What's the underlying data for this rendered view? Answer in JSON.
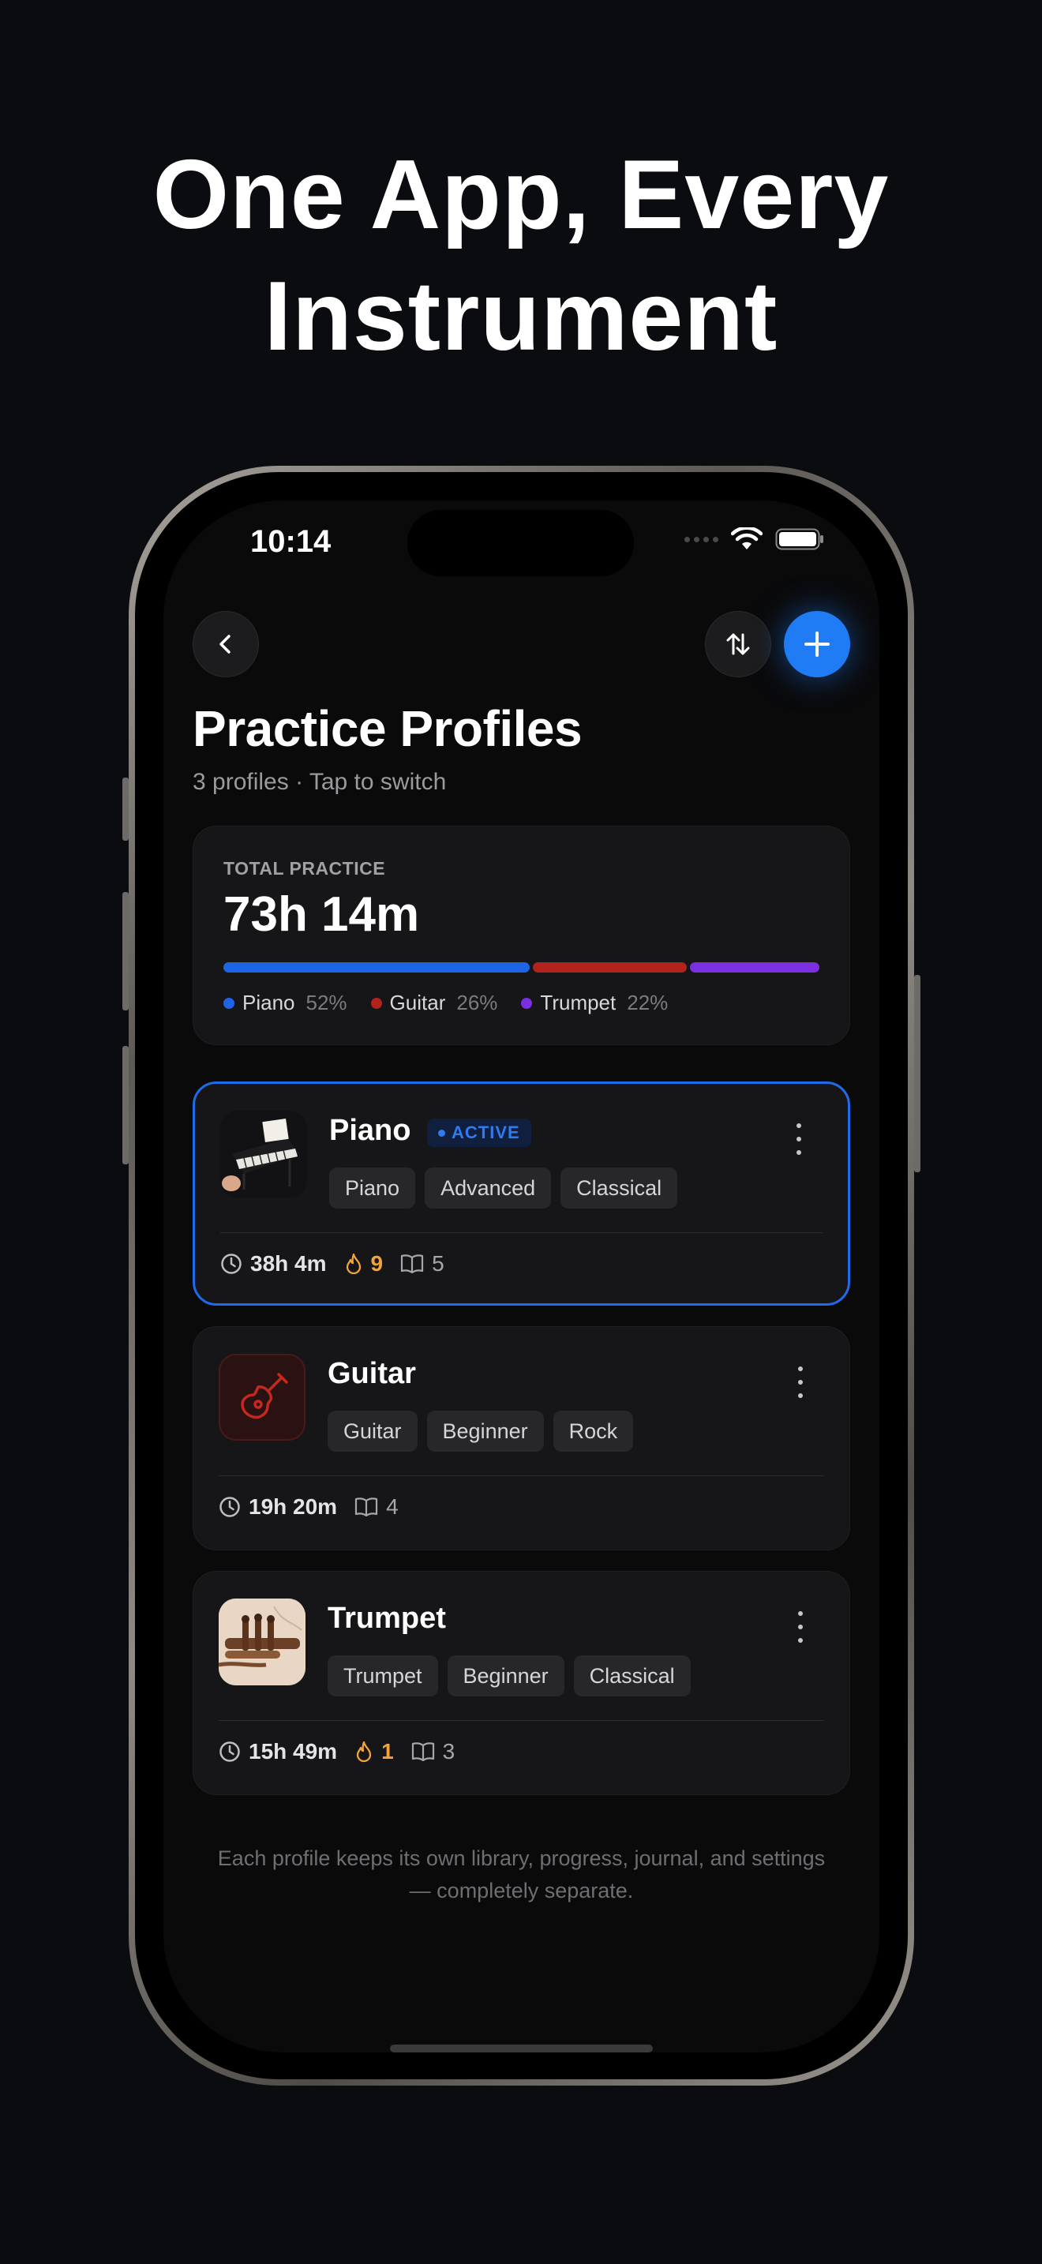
{
  "headline": {
    "line1": "One App, Every",
    "line2": "Instrument"
  },
  "status": {
    "time": "10:14"
  },
  "header": {
    "title": "Practice Profiles",
    "subtitle": "3 profiles · Tap to switch"
  },
  "total": {
    "label": "TOTAL PRACTICE",
    "value": "73h 14m",
    "breakdown": [
      {
        "name": "Piano",
        "pct": "52%",
        "color": "#1e64e6"
      },
      {
        "name": "Guitar",
        "pct": "26%",
        "color": "#b3231d"
      },
      {
        "name": "Trumpet",
        "pct": "22%",
        "color": "#7a2fe0"
      }
    ]
  },
  "profiles": [
    {
      "name": "Piano",
      "badge": "ACTIVE",
      "tags": [
        "Piano",
        "Advanced",
        "Classical"
      ],
      "time": "38h 4m",
      "streak": "9",
      "books": "5",
      "icon": "piano-photo"
    },
    {
      "name": "Guitar",
      "tags": [
        "Guitar",
        "Beginner",
        "Rock"
      ],
      "time": "19h 20m",
      "books": "4",
      "icon": "guitar-icon"
    },
    {
      "name": "Trumpet",
      "tags": [
        "Trumpet",
        "Beginner",
        "Classical"
      ],
      "time": "15h 49m",
      "streak": "1",
      "books": "3",
      "icon": "trumpet-photo"
    }
  ],
  "footer": "Each profile keeps its own library, progress, journal, and settings — completely separate.",
  "colors": {
    "accent": "#1f7cf5",
    "streak": "#f2a33a",
    "background": "#0b0c10"
  }
}
